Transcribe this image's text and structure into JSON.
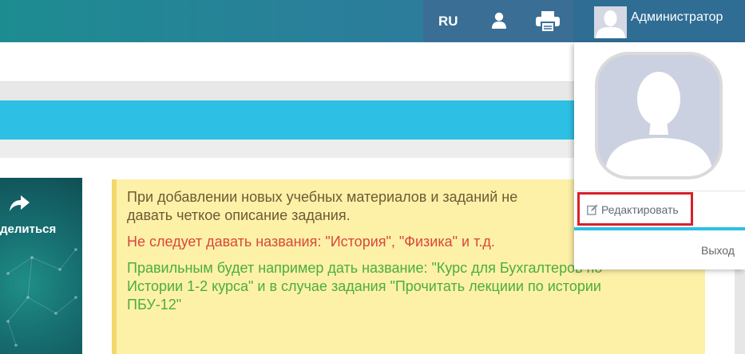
{
  "header": {
    "language": "RU",
    "user_name": "Администратор"
  },
  "card": {
    "share_label": "делиться"
  },
  "notice": {
    "line1": "При добавлении новых учебных материалов и заданий не",
    "line1b": "давать четкое описание задания.",
    "line2": "Не следует давать названия: \"История\", \"Физика\" и т.д.",
    "line3a": "Правильным будет например дать название: \"Курс для Бухгалтеров по",
    "line3b": "Истории 1-2 курса\" и в случае задания \"Прочитать лекциии по истории",
    "line3c": "ПБУ-12\""
  },
  "dropdown": {
    "edit_label": "Редактировать",
    "logout_label": "Выход"
  },
  "colors": {
    "accent_cyan": "#2dc0e4",
    "highlight_red": "#d9202a",
    "notice_bg": "#fdf1a8"
  }
}
